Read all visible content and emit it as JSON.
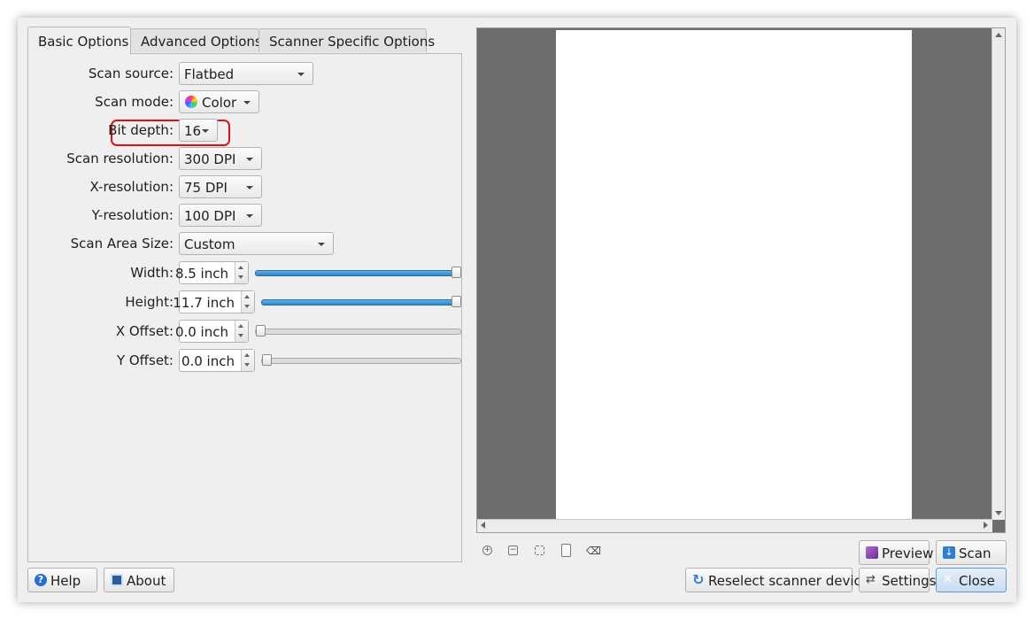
{
  "tabs": [
    {
      "label": "Basic Options"
    },
    {
      "label": "Advanced Options"
    },
    {
      "label": "Scanner Specific Options"
    }
  ],
  "fields": {
    "scan_source": {
      "label": "Scan source:",
      "value": "Flatbed"
    },
    "scan_mode": {
      "label": "Scan mode:",
      "value": "Color"
    },
    "bit_depth": {
      "label": "Bit depth:",
      "value": "16"
    },
    "scan_resolution": {
      "label": "Scan resolution:",
      "value": "300 DPI"
    },
    "x_resolution": {
      "label": "X-resolution:",
      "value": "75 DPI"
    },
    "y_resolution": {
      "label": "Y-resolution:",
      "value": "100 DPI"
    },
    "scan_area_size": {
      "label": "Scan Area Size:",
      "value": "Custom"
    },
    "width": {
      "label": "Width:",
      "value": "8.5 inch",
      "level": 1.0
    },
    "height": {
      "label": "Height:",
      "value": "11.7 inch",
      "level": 1.0
    },
    "x_offset": {
      "label": "X Offset:",
      "value": "0.0 inch",
      "level": 0.0
    },
    "y_offset": {
      "label": "Y Offset:",
      "value": "0.0 inch",
      "level": 0.0
    }
  },
  "buttons": {
    "help": "Help",
    "about": "About",
    "preview": "Preview",
    "scan": "Scan",
    "reselect": "Reselect scanner device",
    "settings": "Settings",
    "close": "Close"
  },
  "colors": {
    "highlight_box": "#e01010",
    "preview_bg": "#6d6d6d",
    "slider_fill": "#2c86c9",
    "close_button": "#cfe3f5"
  }
}
